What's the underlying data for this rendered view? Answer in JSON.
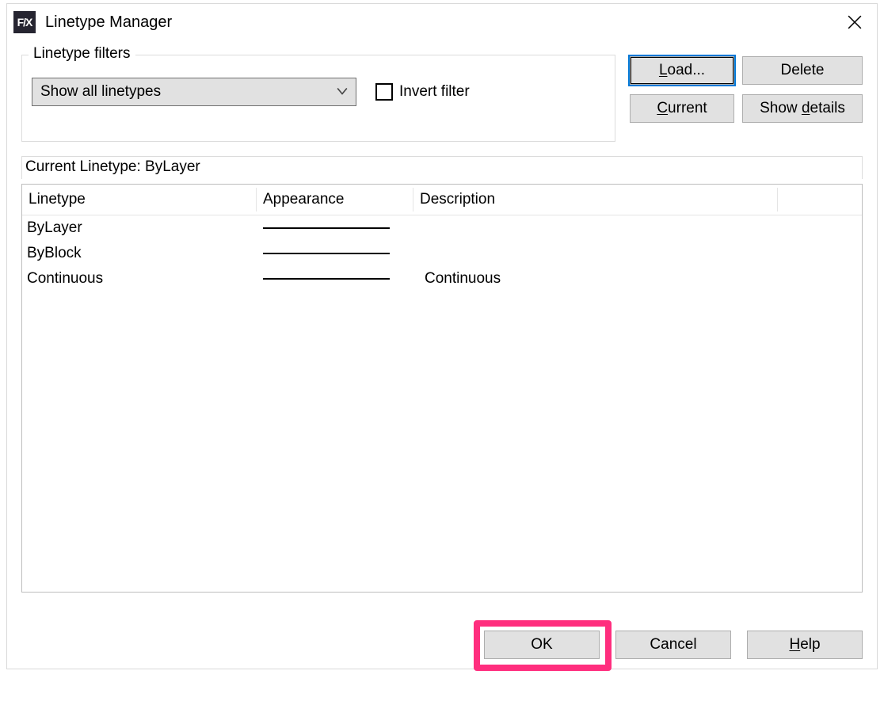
{
  "title": "Linetype Manager",
  "icon_text": "F/X",
  "icon_semantic": "app-fx-icon",
  "filters": {
    "legend": "Linetype filters",
    "combo_value": "Show all linetypes",
    "invert_label": "Invert filter",
    "invert_checked": false
  },
  "buttons": {
    "load_pre": "",
    "load_ul": "L",
    "load_post": "oad...",
    "delete": "Delete",
    "current_pre": "",
    "current_ul": "C",
    "current_post": "urrent",
    "show_details_pre": "Show ",
    "show_details_ul": "d",
    "show_details_post": "etails"
  },
  "status": {
    "label": "Current Linetype:  ",
    "value": "ByLayer"
  },
  "table": {
    "headers": {
      "linetype": "Linetype",
      "appearance": "Appearance",
      "description": "Description"
    },
    "rows": [
      {
        "name": "ByLayer",
        "desc": ""
      },
      {
        "name": "ByBlock",
        "desc": ""
      },
      {
        "name": "Continuous",
        "desc": "Continuous"
      }
    ]
  },
  "footer": {
    "ok": "OK",
    "cancel": "Cancel",
    "help_pre": "",
    "help_ul": "H",
    "help_post": "elp"
  }
}
